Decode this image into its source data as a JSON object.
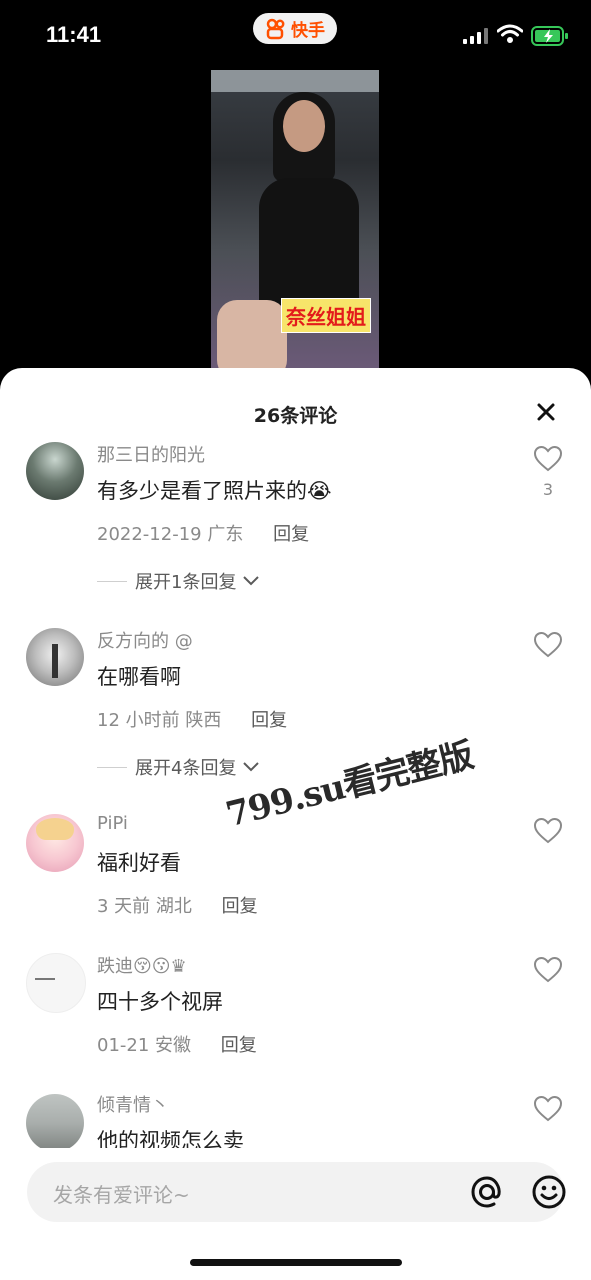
{
  "status_bar": {
    "time": "11:41",
    "app_name": "快手",
    "signal_bars": 4,
    "battery_charging": true
  },
  "video": {
    "caption": "奈丝姐姐"
  },
  "sheet": {
    "title": "26条评论"
  },
  "comments": [
    {
      "username": "那三日的阳光",
      "text": "有多少是看了照片来的😭",
      "date": "2022-12-19",
      "location": "广东",
      "reply_label": "回复",
      "likes": "3",
      "expand_label": "展开1条回复"
    },
    {
      "username": "反方向的 @",
      "text": "在哪看啊",
      "date": "12 小时前",
      "location": "陕西",
      "reply_label": "回复",
      "expand_label": "展开4条回复"
    },
    {
      "username": "PiPi",
      "text": "福利好看",
      "date": "3 天前",
      "location": "湖北",
      "reply_label": "回复"
    },
    {
      "username": "跌迪😚😗♛",
      "text": "四十多个视屏",
      "date": "01-21",
      "location": "安徽",
      "reply_label": "回复"
    },
    {
      "username": "倾青情丶",
      "text": "他的视频怎么卖"
    }
  ],
  "watermark": "799.su看完整版",
  "input": {
    "placeholder": "发条有爱评论~"
  },
  "colors": {
    "accent": "#ff5000",
    "text_primary": "#222222",
    "text_secondary": "#8a8a8a",
    "input_bg": "#f2f2f2"
  },
  "icons": [
    "kuaishou-logo-icon",
    "cellular-signal-icon",
    "wifi-icon",
    "battery-icon",
    "close-icon",
    "heart-icon",
    "chevron-down-icon",
    "at-icon",
    "emoji-icon"
  ]
}
